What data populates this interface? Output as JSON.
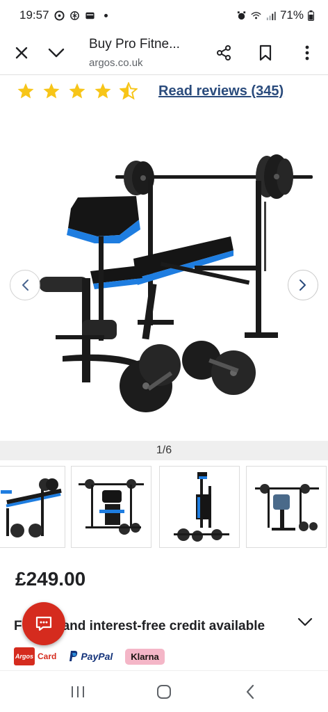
{
  "status": {
    "time": "19:57",
    "battery": "71%"
  },
  "browser": {
    "title": "Buy Pro Fitne...",
    "url": "argos.co.uk"
  },
  "reviews": {
    "rating": 4.5,
    "link_text": "Read reviews (345)"
  },
  "gallery": {
    "counter": "1/6"
  },
  "product": {
    "price": "£249.00"
  },
  "credit": {
    "prefix": "F",
    "text": "and interest-free credit available"
  },
  "payments": {
    "argos_logo": "Argos",
    "argos_label": "Card",
    "paypal": "PayPal",
    "klarna": "Klarna"
  },
  "colors": {
    "star": "#f7c518",
    "link": "#2a4b7c",
    "chat": "#d52b1e",
    "bench_blue": "#1e7de0"
  }
}
